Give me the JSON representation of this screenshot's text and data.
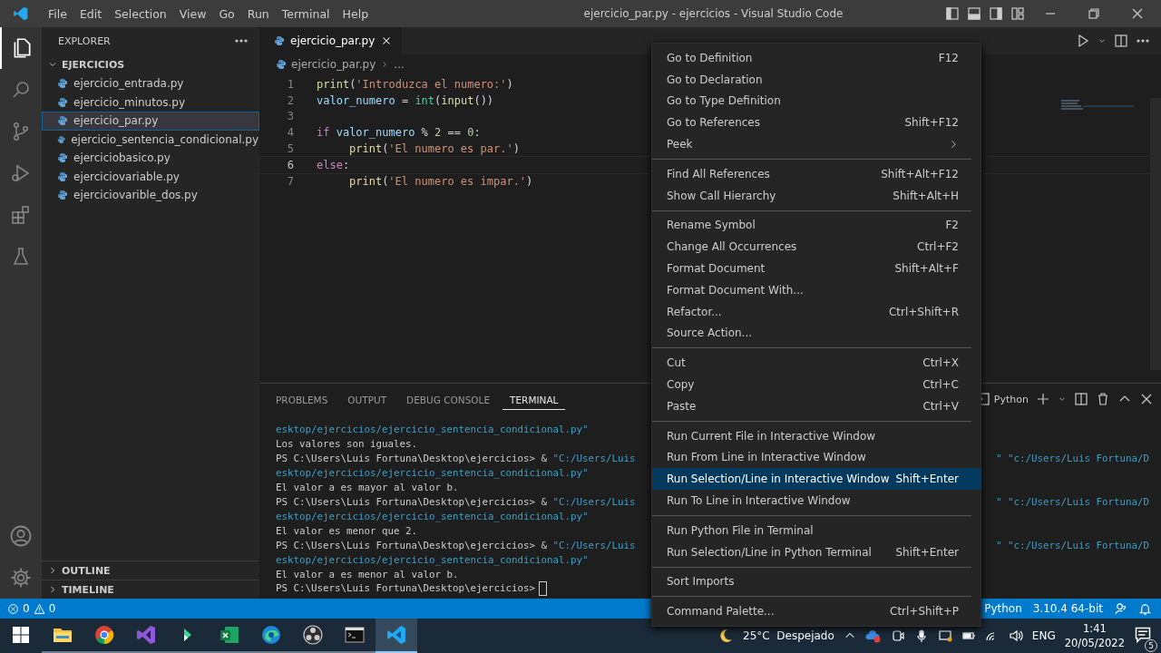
{
  "window": {
    "title": "ejercicio_par.py - ejercicios - Visual Studio Code"
  },
  "menubar": [
    "File",
    "Edit",
    "Selection",
    "View",
    "Go",
    "Run",
    "Terminal",
    "Help"
  ],
  "activity_bar": [
    {
      "kind": "files",
      "selected": true
    },
    {
      "kind": "search",
      "selected": false
    },
    {
      "kind": "scm",
      "selected": false
    },
    {
      "kind": "debug",
      "selected": false
    },
    {
      "kind": "extensions",
      "selected": false
    },
    {
      "kind": "testing",
      "selected": false
    }
  ],
  "sidebar": {
    "title": "EXPLORER",
    "folder": {
      "label": "EJERCICIOS",
      "expanded": true,
      "children": [
        {
          "label": "ejercicio_entrada.py",
          "selected": false
        },
        {
          "label": "ejercicio_minutos.py",
          "selected": false
        },
        {
          "label": "ejercicio_par.py",
          "selected": true
        },
        {
          "label": "ejercicio_sentencia_condicional.py",
          "selected": false
        },
        {
          "label": "ejerciciobasico.py",
          "selected": false
        },
        {
          "label": "ejerciciovariable.py",
          "selected": false
        },
        {
          "label": "ejerciciovarible_dos.py",
          "selected": false
        }
      ]
    },
    "sections": [
      {
        "label": "OUTLINE",
        "expanded": false
      },
      {
        "label": "TIMELINE",
        "expanded": false
      }
    ]
  },
  "editor": {
    "tab": {
      "label": "ejercicio_par.py"
    },
    "breadcrumb": [
      "ejercicio_par.py",
      "..."
    ],
    "lines": [
      {
        "number": "1",
        "current": false,
        "tokens": [
          {
            "t": "print",
            "color": "#dcdcaa"
          },
          {
            "t": "("
          },
          {
            "t": "'Introduzca el numero:'",
            "color": "#ce9178"
          },
          {
            "t": ")"
          }
        ]
      },
      {
        "number": "2",
        "current": false,
        "tokens": [
          {
            "t": "valor_numero ",
            "color": "#9cdcfe"
          },
          {
            "t": "= "
          },
          {
            "t": "int",
            "color": "#4ec9b0"
          },
          {
            "t": "("
          },
          {
            "t": "input",
            "color": "#dcdcaa"
          },
          {
            "t": "())"
          }
        ]
      },
      {
        "number": "3",
        "current": false
      },
      {
        "number": "4",
        "current": false,
        "tokens": [
          {
            "t": "if ",
            "color": "#c586c0"
          },
          {
            "t": "valor_numero ",
            "color": "#9cdcfe"
          },
          {
            "t": "% "
          },
          {
            "t": "2 ",
            "color": "#b5cea8"
          },
          {
            "t": "== "
          },
          {
            "t": "0",
            "color": "#b5cea8"
          },
          {
            "t": ":"
          }
        ],
        "children": [
          {
            "number": "5",
            "current": false,
            "tokens": [
              {
                "t": "print",
                "color": "#dcdcaa"
              },
              {
                "t": "("
              },
              {
                "t": "'El numero es par.'",
                "color": "#ce9178"
              },
              {
                "t": ")"
              }
            ]
          }
        ]
      },
      {
        "number": "6",
        "current": true,
        "tokens": [
          {
            "t": "else",
            "color": "#c586c0"
          },
          {
            "t": ":"
          }
        ],
        "children": [
          {
            "number": "7",
            "current": false,
            "tokens": [
              {
                "t": "print",
                "color": "#dcdcaa"
              },
              {
                "t": "("
              },
              {
                "t": "'El numero es impar.'",
                "color": "#ce9178"
              },
              {
                "t": ")"
              }
            ]
          }
        ]
      }
    ]
  },
  "panel": {
    "tabs": [
      {
        "label": "PROBLEMS",
        "selected": false
      },
      {
        "label": "OUTPUT",
        "selected": false
      },
      {
        "label": "DEBUG CONSOLE",
        "selected": false
      },
      {
        "label": "TERMINAL",
        "selected": true
      }
    ],
    "terminal_name": "Python",
    "lines": [
      {
        "segments": [
          {
            "t": "esktop/ejercicios/ejercicio_sentencia_condicional.py\"",
            "color": "#3b9fc6"
          }
        ]
      },
      {
        "segments": [
          {
            "t": "Los valores son iguales.",
            "color": "#cccccc"
          }
        ]
      },
      {
        "segments": [
          {
            "t": "PS C:\\Users\\Luis Fortuna\\Desktop\\ejercicios> & ",
            "color": "#cccccc"
          },
          {
            "t": "\"C:/Users/Luis",
            "color": "#3b9fc6"
          }
        ],
        "tail": "\" \"c:/Users/Luis Fortuna/D"
      },
      {
        "segments": [
          {
            "t": "esktop/ejercicios/ejercicio_sentencia_condicional.py\"",
            "color": "#3b9fc6"
          }
        ]
      },
      {
        "segments": [
          {
            "t": "El valor a es mayor al valor b.",
            "color": "#cccccc"
          }
        ]
      },
      {
        "segments": [
          {
            "t": "PS C:\\Users\\Luis Fortuna\\Desktop\\ejercicios> & ",
            "color": "#cccccc"
          },
          {
            "t": "\"C:/Users/Luis",
            "color": "#3b9fc6"
          }
        ],
        "tail": "\" \"c:/Users/Luis Fortuna/D"
      },
      {
        "segments": [
          {
            "t": "esktop/ejercicios/ejercicio_sentencia_condicional.py\"",
            "color": "#3b9fc6"
          }
        ]
      },
      {
        "segments": [
          {
            "t": "El valor es menor que 2.",
            "color": "#cccccc"
          }
        ]
      },
      {
        "segments": [
          {
            "t": "PS C:\\Users\\Luis Fortuna\\Desktop\\ejercicios> & ",
            "color": "#cccccc"
          },
          {
            "t": "\"C:/Users/Luis",
            "color": "#3b9fc6"
          }
        ],
        "tail": "\" \"c:/Users/Luis Fortuna/D"
      },
      {
        "segments": [
          {
            "t": "esktop/ejercicios/ejercicio_sentencia_condicional.py\"",
            "color": "#3b9fc6"
          }
        ]
      },
      {
        "segments": [
          {
            "t": "El valor a es menor al valor b.",
            "color": "#cccccc"
          }
        ]
      },
      {
        "segments": [
          {
            "t": "PS C:\\Users\\Luis Fortuna\\Desktop\\ejercicios>",
            "color": "#cccccc"
          }
        ],
        "cursor": true
      }
    ]
  },
  "context_menu": {
    "groups": [
      [
        {
          "label": "Go to Definition",
          "shortcut": "F12",
          "selected": false
        },
        {
          "label": "Go to Declaration",
          "selected": false
        },
        {
          "label": "Go to Type Definition",
          "selected": false
        },
        {
          "label": "Go to References",
          "shortcut": "Shift+F12",
          "selected": false
        },
        {
          "label": "Peek",
          "submenu": true,
          "selected": false
        }
      ],
      [
        {
          "label": "Find All References",
          "shortcut": "Shift+Alt+F12",
          "selected": false
        },
        {
          "label": "Show Call Hierarchy",
          "shortcut": "Shift+Alt+H",
          "selected": false
        }
      ],
      [
        {
          "label": "Rename Symbol",
          "shortcut": "F2",
          "selected": false
        },
        {
          "label": "Change All Occurrences",
          "shortcut": "Ctrl+F2",
          "selected": false
        },
        {
          "label": "Format Document",
          "shortcut": "Shift+Alt+F",
          "selected": false
        },
        {
          "label": "Format Document With...",
          "selected": false
        },
        {
          "label": "Refactor...",
          "shortcut": "Ctrl+Shift+R",
          "selected": false
        },
        {
          "label": "Source Action...",
          "selected": false
        }
      ],
      [
        {
          "label": "Cut",
          "shortcut": "Ctrl+X",
          "selected": false
        },
        {
          "label": "Copy",
          "shortcut": "Ctrl+C",
          "selected": false
        },
        {
          "label": "Paste",
          "shortcut": "Ctrl+V",
          "selected": false
        }
      ],
      [
        {
          "label": "Run Current File in Interactive Window",
          "selected": false
        },
        {
          "label": "Run From Line in Interactive Window",
          "selected": false
        },
        {
          "label": "Run Selection/Line in Interactive Window",
          "shortcut": "Shift+Enter",
          "selected": true
        },
        {
          "label": "Run To Line in Interactive Window",
          "selected": false
        }
      ],
      [
        {
          "label": "Run Python File in Terminal",
          "selected": false
        },
        {
          "label": "Run Selection/Line in Python Terminal",
          "shortcut": "Shift+Enter",
          "selected": false
        }
      ],
      [
        {
          "label": "Sort Imports",
          "selected": false
        }
      ],
      [
        {
          "label": "Command Palette...",
          "shortcut": "Ctrl+Shift+P",
          "selected": false
        }
      ]
    ]
  },
  "status_bar": {
    "errors": "0",
    "warnings": "0",
    "language": "Python",
    "interpreter": "3.10.4 64-bit"
  },
  "taskbar": {
    "apps": [
      {
        "kind": "folder",
        "active": false
      },
      {
        "kind": "chrome",
        "active": false
      },
      {
        "kind": "vs",
        "active": false
      },
      {
        "kind": "green",
        "active": false
      },
      {
        "kind": "excel",
        "active": false
      },
      {
        "kind": "edge",
        "active": false
      },
      {
        "kind": "obs",
        "active": false
      },
      {
        "kind": "terminal",
        "active": false
      },
      {
        "kind": "vscode",
        "active": true
      }
    ],
    "weather": "25°C  Despejado",
    "language": "ENG",
    "time": "1:41",
    "date": "20/05/2022",
    "notifications": "5"
  }
}
